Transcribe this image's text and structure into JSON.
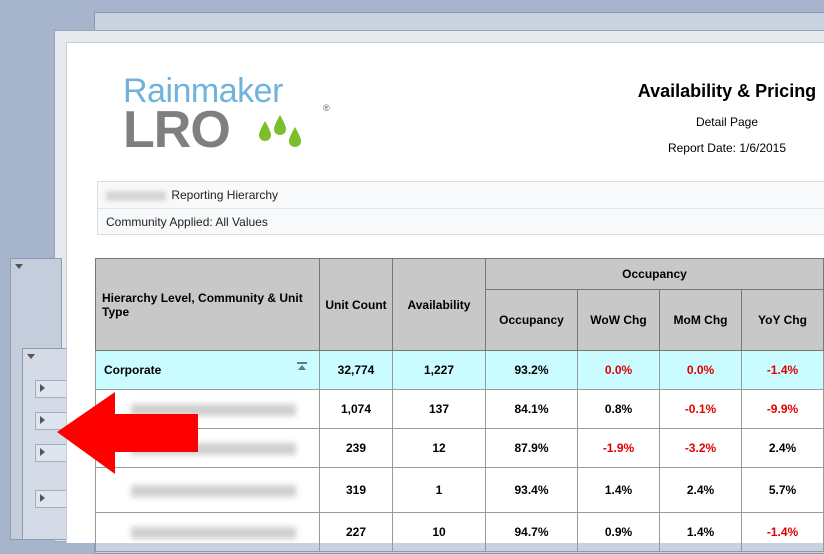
{
  "brand": {
    "line1": "Rainmaker",
    "line2": "LRO",
    "registered": "®"
  },
  "header": {
    "title": "Availability & Pricing",
    "subtitle": "Detail Page",
    "report_date": "Report Date: 1/6/2015"
  },
  "filters": {
    "hierarchy_label": "Reporting Hierarchy",
    "community_label": "Community Applied: All Values"
  },
  "table": {
    "headers": {
      "hierarchy": "Hierarchy Level, Community & Unit Type",
      "unit_count": "Unit Count",
      "availability": "Availability",
      "occupancy_group": "Occupancy",
      "occupancy": "Occupancy",
      "wow": "WoW Chg",
      "mom": "MoM Chg",
      "yoy": "YoY Chg"
    },
    "corporate": {
      "name": "Corporate",
      "unit_count": "32,774",
      "availability": "1,227",
      "occupancy": "93.2%",
      "wow": "0.0%",
      "mom": "0.0%",
      "yoy": "-1.4%"
    },
    "rows": [
      {
        "unit_count": "1,074",
        "availability": "137",
        "occupancy": "84.1%",
        "wow": "0.8%",
        "mom": "-0.1%",
        "yoy": "-9.9%"
      },
      {
        "unit_count": "239",
        "availability": "12",
        "occupancy": "87.9%",
        "wow": "-1.9%",
        "mom": "-3.2%",
        "yoy": "2.4%"
      },
      {
        "unit_count": "319",
        "availability": "1",
        "occupancy": "93.4%",
        "wow": "1.4%",
        "mom": "2.4%",
        "yoy": "5.7%"
      },
      {
        "unit_count": "227",
        "availability": "10",
        "occupancy": "94.7%",
        "wow": "0.9%",
        "mom": "1.4%",
        "yoy": "-1.4%"
      }
    ]
  },
  "colors": {
    "negative": "#e00000",
    "corporate_row": "#c9fbff",
    "header_bg": "#c8c8c8",
    "arrow": "#ff0000"
  }
}
